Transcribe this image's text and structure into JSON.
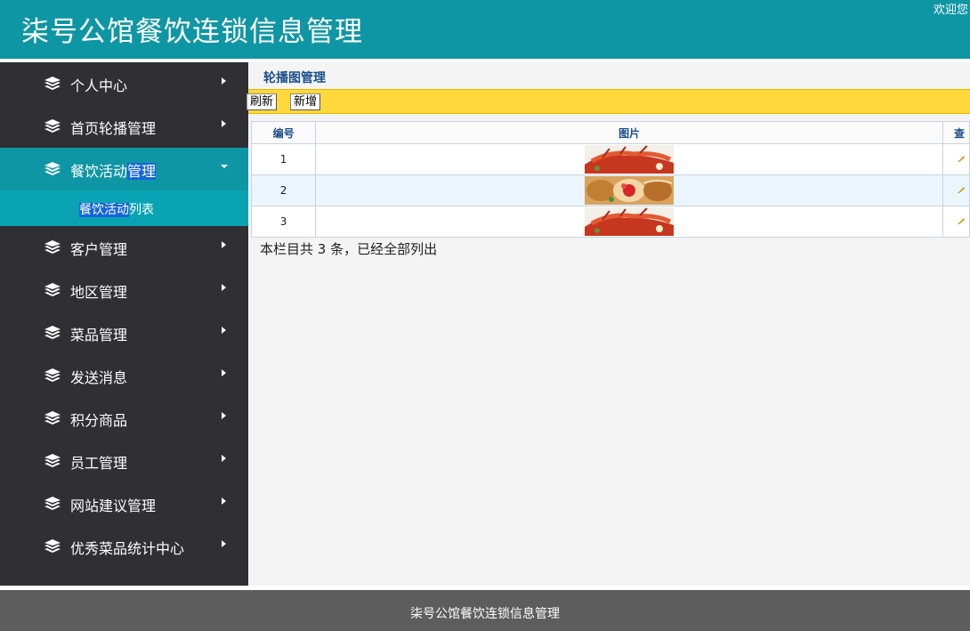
{
  "header": {
    "title": "柒号公馆餐饮连锁信息管理",
    "welcome": "欢迎您"
  },
  "sidebar": {
    "items": [
      {
        "label": "个人中心"
      },
      {
        "label": "首页轮播管理"
      },
      {
        "label_part1": "餐饮活动",
        "label_part2": "管理",
        "expanded": true
      },
      {
        "label": "客户管理"
      },
      {
        "label": "地区管理"
      },
      {
        "label": "菜品管理"
      },
      {
        "label": "发送消息"
      },
      {
        "label": "积分商品"
      },
      {
        "label": "员工管理"
      },
      {
        "label": "网站建议管理"
      },
      {
        "label": "优秀菜品统计中心"
      }
    ],
    "subitem": {
      "label_part1": "餐饮活动",
      "label_part2": "列表"
    }
  },
  "main": {
    "page_title": "轮播图管理",
    "toolbar": {
      "refresh_label": "刷新",
      "add_label": "新增"
    },
    "table": {
      "columns": [
        "编号",
        "图片",
        "查"
      ],
      "rows": [
        {
          "id": "1",
          "image": "lobster-dish-image"
        },
        {
          "id": "2",
          "image": "assorted-pastries-image"
        },
        {
          "id": "3",
          "image": "lobster-dish-image"
        }
      ]
    },
    "summary": "本栏目共 3 条，已经全部列出"
  },
  "footer": {
    "text": "柒号公馆餐饮连锁信息管理"
  },
  "colors": {
    "header_bg": "#0f96a4",
    "sidebar_bg": "#2f2f34",
    "sidebar_active": "#0f96a4",
    "toolbar_bg": "#ffd83c",
    "footer_bg": "#5d5d5d"
  }
}
